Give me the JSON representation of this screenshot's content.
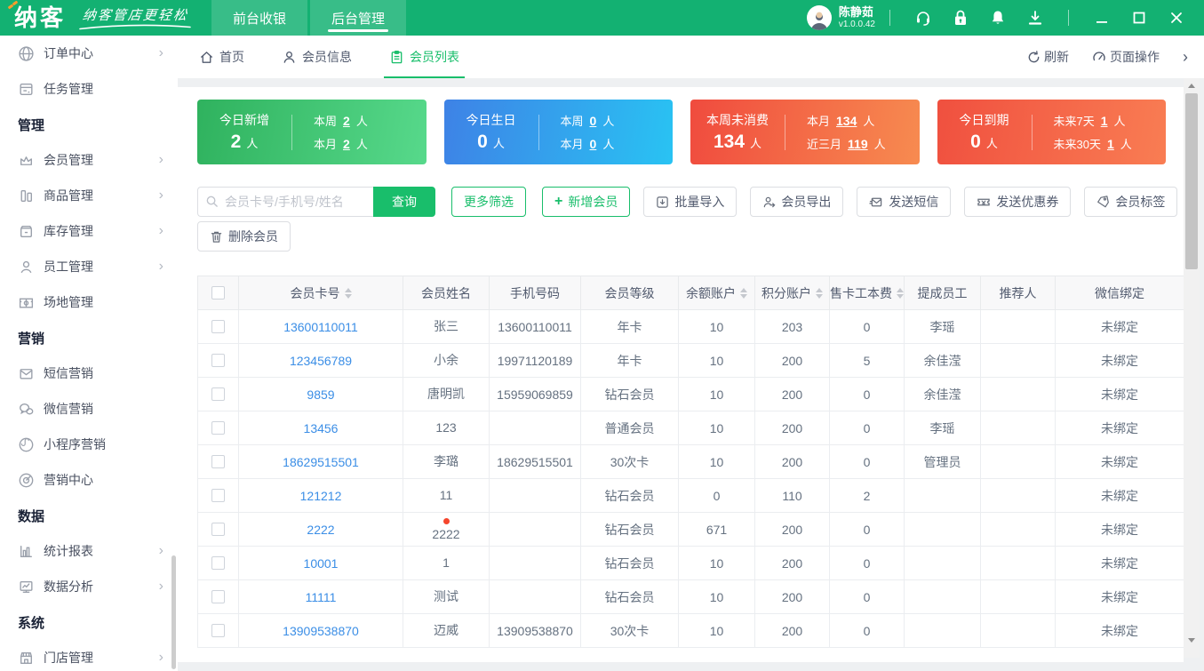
{
  "topbar": {
    "logo": "纳客",
    "slogan": "纳客管店更轻松",
    "nav_tabs": [
      {
        "label": "前台收银"
      },
      {
        "label": "后台管理"
      }
    ],
    "user_name": "陈静茹",
    "version": "v1.0.0.42"
  },
  "sidebar": {
    "items": [
      {
        "label": "订单中心"
      },
      {
        "label": "任务管理"
      },
      {
        "label": "管理"
      },
      {
        "label": "会员管理"
      },
      {
        "label": "商品管理"
      },
      {
        "label": "库存管理"
      },
      {
        "label": "员工管理"
      },
      {
        "label": "场地管理"
      },
      {
        "label": "营销"
      },
      {
        "label": "短信营销"
      },
      {
        "label": "微信营销"
      },
      {
        "label": "小程序营销"
      },
      {
        "label": "营销中心"
      },
      {
        "label": "数据"
      },
      {
        "label": "统计报表"
      },
      {
        "label": "数据分析"
      },
      {
        "label": "系统"
      },
      {
        "label": "门店管理"
      }
    ]
  },
  "pagetabs": {
    "tabs": [
      {
        "label": "首页"
      },
      {
        "label": "会员信息"
      },
      {
        "label": "会员列表"
      }
    ],
    "refresh_label": "刷新",
    "page_ops_label": "页面操作"
  },
  "cards": [
    {
      "title": "今日新增",
      "value": "2",
      "unit": "人",
      "colors": {
        "from": "#2fb25e",
        "to": "#57d98b"
      },
      "stats": [
        {
          "label": "本周",
          "num": "2",
          "unit": "人"
        },
        {
          "label": "本月",
          "num": "2",
          "unit": "人"
        }
      ]
    },
    {
      "title": "今日生日",
      "value": "0",
      "unit": "人",
      "colors": {
        "from": "#3e82e6",
        "to": "#29c3f3"
      },
      "stats": [
        {
          "label": "本周",
          "num": "0",
          "unit": "人"
        },
        {
          "label": "本月",
          "num": "0",
          "unit": "人"
        }
      ]
    },
    {
      "title": "本周未消费",
      "value": "134",
      "unit": "人",
      "colors": {
        "from": "#f04b3e",
        "to": "#f78b50"
      },
      "stats": [
        {
          "label": "本月",
          "num": "134",
          "unit": "人"
        },
        {
          "label": "近三月",
          "num": "119",
          "unit": "人"
        }
      ]
    },
    {
      "title": "今日到期",
      "value": "0",
      "unit": "人",
      "colors": {
        "from": "#f0503f",
        "to": "#f97d53"
      },
      "stats": [
        {
          "label": "未来7天",
          "num": "1",
          "unit": "人"
        },
        {
          "label": "未来30天",
          "num": "1",
          "unit": "人"
        }
      ]
    }
  ],
  "toolbar": {
    "search_placeholder": "会员卡号/手机号/姓名",
    "query": "查询",
    "more_filter": "更多筛选",
    "add_member": "新增会员",
    "batch_import": "批量导入",
    "member_export": "会员导出",
    "send_sms": "发送短信",
    "send_coupon": "发送优惠券",
    "member_tag": "会员标签",
    "delete_member": "删除会员"
  },
  "table": {
    "headers": [
      "会员卡号",
      "会员姓名",
      "手机号码",
      "会员等级",
      "余额账户",
      "积分账户",
      "售卡工本费",
      "提成员工",
      "推荐人",
      "微信绑定"
    ],
    "rows": [
      {
        "card_no": "13600110011",
        "name": "张三",
        "dot": false,
        "phone": "13600110011",
        "level": "年卡",
        "balance": "10",
        "points": "203",
        "card_fee": "0",
        "staff": "李瑶",
        "referrer": "",
        "wechat": "未绑定"
      },
      {
        "card_no": "123456789",
        "name": "小余",
        "dot": false,
        "phone": "19971120189",
        "level": "年卡",
        "balance": "10",
        "points": "200",
        "card_fee": "5",
        "staff": "余佳滢",
        "referrer": "",
        "wechat": "未绑定"
      },
      {
        "card_no": "9859",
        "name": "唐明凯",
        "dot": false,
        "phone": "15959069859",
        "level": "钻石会员",
        "balance": "10",
        "points": "200",
        "card_fee": "0",
        "staff": "余佳滢",
        "referrer": "",
        "wechat": "未绑定"
      },
      {
        "card_no": "13456",
        "name": "123",
        "dot": false,
        "phone": "",
        "level": "普通会员",
        "balance": "10",
        "points": "200",
        "card_fee": "0",
        "staff": "李瑶",
        "referrer": "",
        "wechat": "未绑定"
      },
      {
        "card_no": "18629515501",
        "name": "李璐",
        "dot": false,
        "phone": "18629515501",
        "level": "30次卡",
        "balance": "10",
        "points": "200",
        "card_fee": "0",
        "staff": "管理员",
        "referrer": "",
        "wechat": "未绑定"
      },
      {
        "card_no": "121212",
        "name": "11",
        "dot": false,
        "phone": "",
        "level": "钻石会员",
        "balance": "0",
        "points": "110",
        "card_fee": "2",
        "staff": "",
        "referrer": "",
        "wechat": "未绑定"
      },
      {
        "card_no": "2222",
        "name": "2222",
        "dot": true,
        "phone": "",
        "level": "钻石会员",
        "balance": "671",
        "points": "200",
        "card_fee": "0",
        "staff": "",
        "referrer": "",
        "wechat": "未绑定"
      },
      {
        "card_no": "10001",
        "name": "1",
        "dot": false,
        "phone": "",
        "level": "钻石会员",
        "balance": "10",
        "points": "200",
        "card_fee": "0",
        "staff": "",
        "referrer": "",
        "wechat": "未绑定"
      },
      {
        "card_no": "11111",
        "name": "测试",
        "dot": false,
        "phone": "",
        "level": "钻石会员",
        "balance": "10",
        "points": "200",
        "card_fee": "0",
        "staff": "",
        "referrer": "",
        "wechat": "未绑定"
      },
      {
        "card_no": "13909538870",
        "name": "迈威",
        "dot": false,
        "phone": "13909538870",
        "level": "30次卡",
        "balance": "10",
        "points": "200",
        "card_fee": "0",
        "staff": "",
        "referrer": "",
        "wechat": "未绑定"
      }
    ]
  }
}
